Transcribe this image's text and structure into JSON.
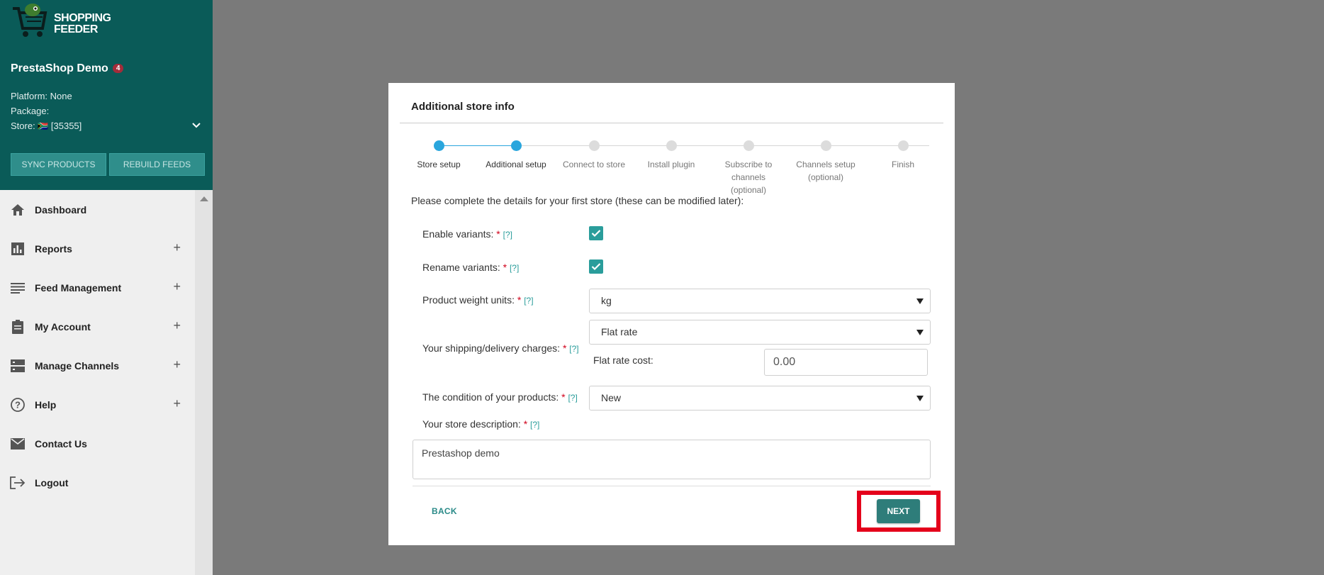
{
  "sidebar": {
    "logo_text_line1": "SHOPPING",
    "logo_text_line2": "FEEDER",
    "store_name": "PrestaShop Demo",
    "notification_count": "4",
    "platform": "Platform: None",
    "package": "Package:",
    "store_prefix": "Store:",
    "store_flag": "🇿🇦",
    "store_id": "[35355]",
    "sync_label": "SYNC PRODUCTS",
    "rebuild_label": "REBUILD FEEDS",
    "nav": [
      {
        "label": "Dashboard",
        "icon": "home-icon",
        "expandable": false
      },
      {
        "label": "Reports",
        "icon": "bar-chart-icon",
        "expandable": true
      },
      {
        "label": "Feed Management",
        "icon": "list-icon",
        "expandable": true
      },
      {
        "label": "My Account",
        "icon": "clipboard-icon",
        "expandable": true
      },
      {
        "label": "Manage Channels",
        "icon": "server-icon",
        "expandable": true
      },
      {
        "label": "Help",
        "icon": "help-circle-icon",
        "expandable": true
      },
      {
        "label": "Contact Us",
        "icon": "mail-icon",
        "expandable": false
      },
      {
        "label": "Logout",
        "icon": "logout-icon",
        "expandable": false
      }
    ],
    "plus": "+"
  },
  "modal": {
    "title": "Additional store info",
    "steps": [
      {
        "label": "Store setup",
        "state": "done"
      },
      {
        "label": "Additional setup",
        "state": "active"
      },
      {
        "label": "Connect to store",
        "state": "pending"
      },
      {
        "label": "Install plugin",
        "state": "pending"
      },
      {
        "label": "Subscribe to channels (optional)",
        "state": "pending"
      },
      {
        "label": "Channels setup (optional)",
        "state": "pending"
      },
      {
        "label": "Finish",
        "state": "pending"
      }
    ],
    "intro": "Please complete the details for your first store (these can be modified later):",
    "required_mark": "*",
    "help_mark": "[?]",
    "fields": {
      "enable_variants": {
        "label": "Enable variants:",
        "checked": true
      },
      "rename_variants": {
        "label": "Rename variants:",
        "checked": true
      },
      "weight_units": {
        "label": "Product weight units:",
        "value": "kg"
      },
      "shipping": {
        "label": "Your shipping/delivery charges:",
        "value": "Flat rate",
        "sub_label": "Flat rate cost:",
        "sub_value": "0.00"
      },
      "condition": {
        "label": "The condition of your products:",
        "value": "New"
      },
      "description": {
        "label": "Your store description:",
        "value": "Prestashop demo"
      }
    },
    "back_label": "BACK",
    "next_label": "NEXT"
  },
  "colors": {
    "sidebar_header": "#0a5b58",
    "accent": "#2a9d9b",
    "step_active": "#2aa6dd",
    "highlight": "#e4001b"
  }
}
